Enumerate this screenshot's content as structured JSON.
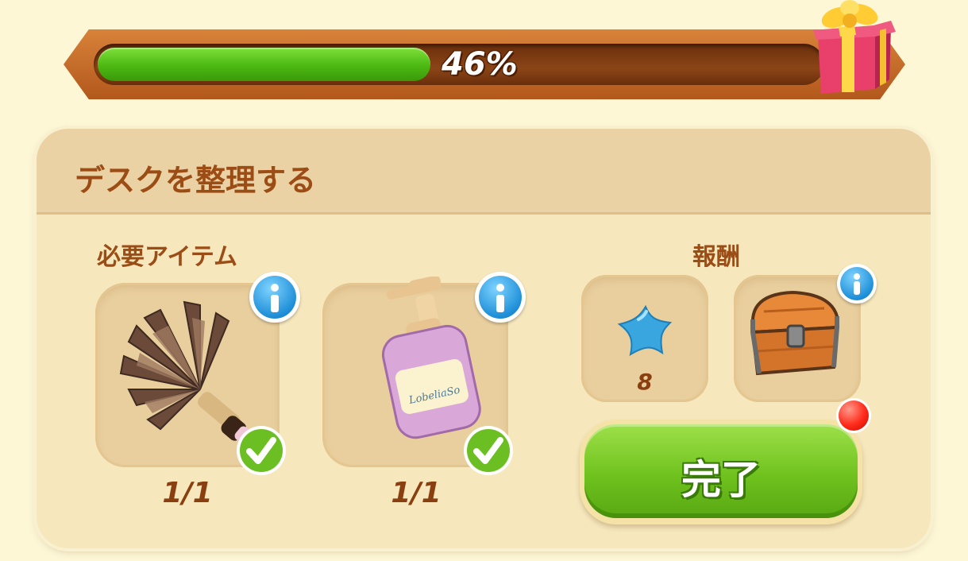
{
  "progress": {
    "percent": 46,
    "label": "46%"
  },
  "quest": {
    "title": "デスクを整理する",
    "required_label": "必要アイテム",
    "reward_label": "報酬",
    "items": [
      {
        "icon": "feather-duster-icon",
        "count": "1/1",
        "completed": true
      },
      {
        "icon": "soap-bottle-icon",
        "bottle_text": "LobeliaSo",
        "count": "1/1",
        "completed": true
      }
    ],
    "rewards": [
      {
        "icon": "blue-star-icon",
        "count": "8"
      },
      {
        "icon": "treasure-chest-icon"
      }
    ],
    "complete_button": "完了"
  },
  "colors": {
    "title_brown": "#9c4d16",
    "progress_green": "#4cb812",
    "button_green": "#6fc21e",
    "info_blue": "#1e8fd8"
  }
}
